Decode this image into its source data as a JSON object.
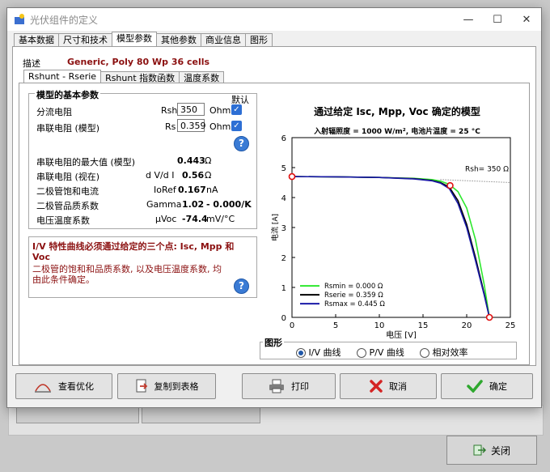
{
  "background": {
    "close_button_label": "关闭"
  },
  "window": {
    "title": "光伏组件的定义",
    "minimize": "—",
    "maximize": "☐",
    "close": "✕"
  },
  "tabs": [
    "基本数据",
    "尺寸和技术",
    "模型参数",
    "其他参数",
    "商业信息",
    "图形"
  ],
  "description": {
    "label": "描述",
    "value": "Generic, Poly 80 Wp 36 cells"
  },
  "subtabs": [
    "Rshunt - Rserie",
    "Rshunt 指数函数",
    "温度系数"
  ],
  "model_params": {
    "group_title": "模型的基本参数",
    "default_header": "默认",
    "shunt_label": "分流电阻",
    "shunt_symbol": "Rsh",
    "shunt_value": "350",
    "shunt_unit": "Ohm",
    "series_label": "串联电阻 (模型)",
    "series_symbol": "Rs",
    "series_value": "0.359",
    "series_unit": "Ohm",
    "max_series_label": "串联电阻的最大值 (模型)",
    "max_series_value": "0.443",
    "max_series_unit": "Ω",
    "apparent_series_label": "串联电阻 (视在)",
    "apparent_series_symbol": "d V/d I",
    "apparent_series_value": "0.56",
    "apparent_series_unit": "Ω",
    "diode_sat_label": "二极管饱和电流",
    "diode_sat_symbol": "IoRef",
    "diode_sat_value": "0.167",
    "diode_sat_unit": "nA",
    "diode_quality_label": "二极管品质系数",
    "diode_quality_symbol": "Gamma",
    "diode_quality_value": "1.02",
    "diode_quality_extra": "- 0.000/K",
    "voltage_temp_label": "电压温度系数",
    "voltage_temp_symbol": "μVoc",
    "voltage_temp_value": "-74.4",
    "voltage_temp_unit": "mV/°C"
  },
  "info_box": {
    "title": "I/V 特性曲线必须通过给定的三个点: Isc, Mpp 和 Voc",
    "text": "二极管的饱和和品质系数, 以及电压温度系数, 均由此条件确定。"
  },
  "chart_data": {
    "type": "line",
    "title": "通过给定 Isc, Mpp, Voc 确定的模型",
    "subtitle": "入射辐照度 = 1000 W/m², 电池片温度 = 25 °C",
    "xlabel": "电压 [V]",
    "ylabel": "电流 [A]",
    "xlim": [
      0,
      25
    ],
    "ylim": [
      0,
      6
    ],
    "xticks": [
      0,
      5,
      10,
      15,
      20,
      25
    ],
    "yticks": [
      0,
      1,
      2,
      3,
      4,
      5,
      6
    ],
    "annotation": "Rsh= 350 Ω",
    "series": [
      {
        "name": "Rsmin = 0.000 Ω",
        "color": "#2ee82e",
        "x": [
          0,
          5,
          10,
          14,
          16,
          17,
          18,
          19,
          20,
          21,
          22,
          22.6
        ],
        "y": [
          4.7,
          4.69,
          4.67,
          4.64,
          4.6,
          4.55,
          4.44,
          4.2,
          3.65,
          2.6,
          1.1,
          0
        ]
      },
      {
        "name": "Rserie = 0.359 Ω",
        "color": "#000000",
        "x": [
          0,
          5,
          10,
          14,
          16,
          17,
          18,
          19,
          20,
          21,
          22,
          22.6
        ],
        "y": [
          4.7,
          4.69,
          4.67,
          4.63,
          4.57,
          4.5,
          4.35,
          3.9,
          3.1,
          2.0,
          0.8,
          0
        ]
      },
      {
        "name": "Rsmax = 0.445 Ω",
        "color": "#1a1aa8",
        "x": [
          0,
          5,
          10,
          14,
          16,
          17,
          18,
          19,
          20,
          21,
          22,
          22.6
        ],
        "y": [
          4.7,
          4.69,
          4.67,
          4.62,
          4.56,
          4.48,
          4.3,
          3.8,
          3.0,
          1.9,
          0.75,
          0
        ]
      }
    ],
    "key_points": [
      {
        "name": "Isc",
        "x": 0,
        "y": 4.7
      },
      {
        "name": "Mpp",
        "x": 18.1,
        "y": 4.4
      },
      {
        "name": "Voc",
        "x": 22.6,
        "y": 0
      }
    ],
    "legend_position": "bottom-left"
  },
  "graph_options": {
    "group_title": "图形",
    "options": [
      "I/V 曲线",
      "P/V 曲线",
      "相对效率"
    ],
    "selected": "I/V 曲线"
  },
  "buttons": {
    "optimize": "查看优化",
    "copy": "复制到表格",
    "print": "打印",
    "cancel": "取消",
    "ok": "确定"
  }
}
